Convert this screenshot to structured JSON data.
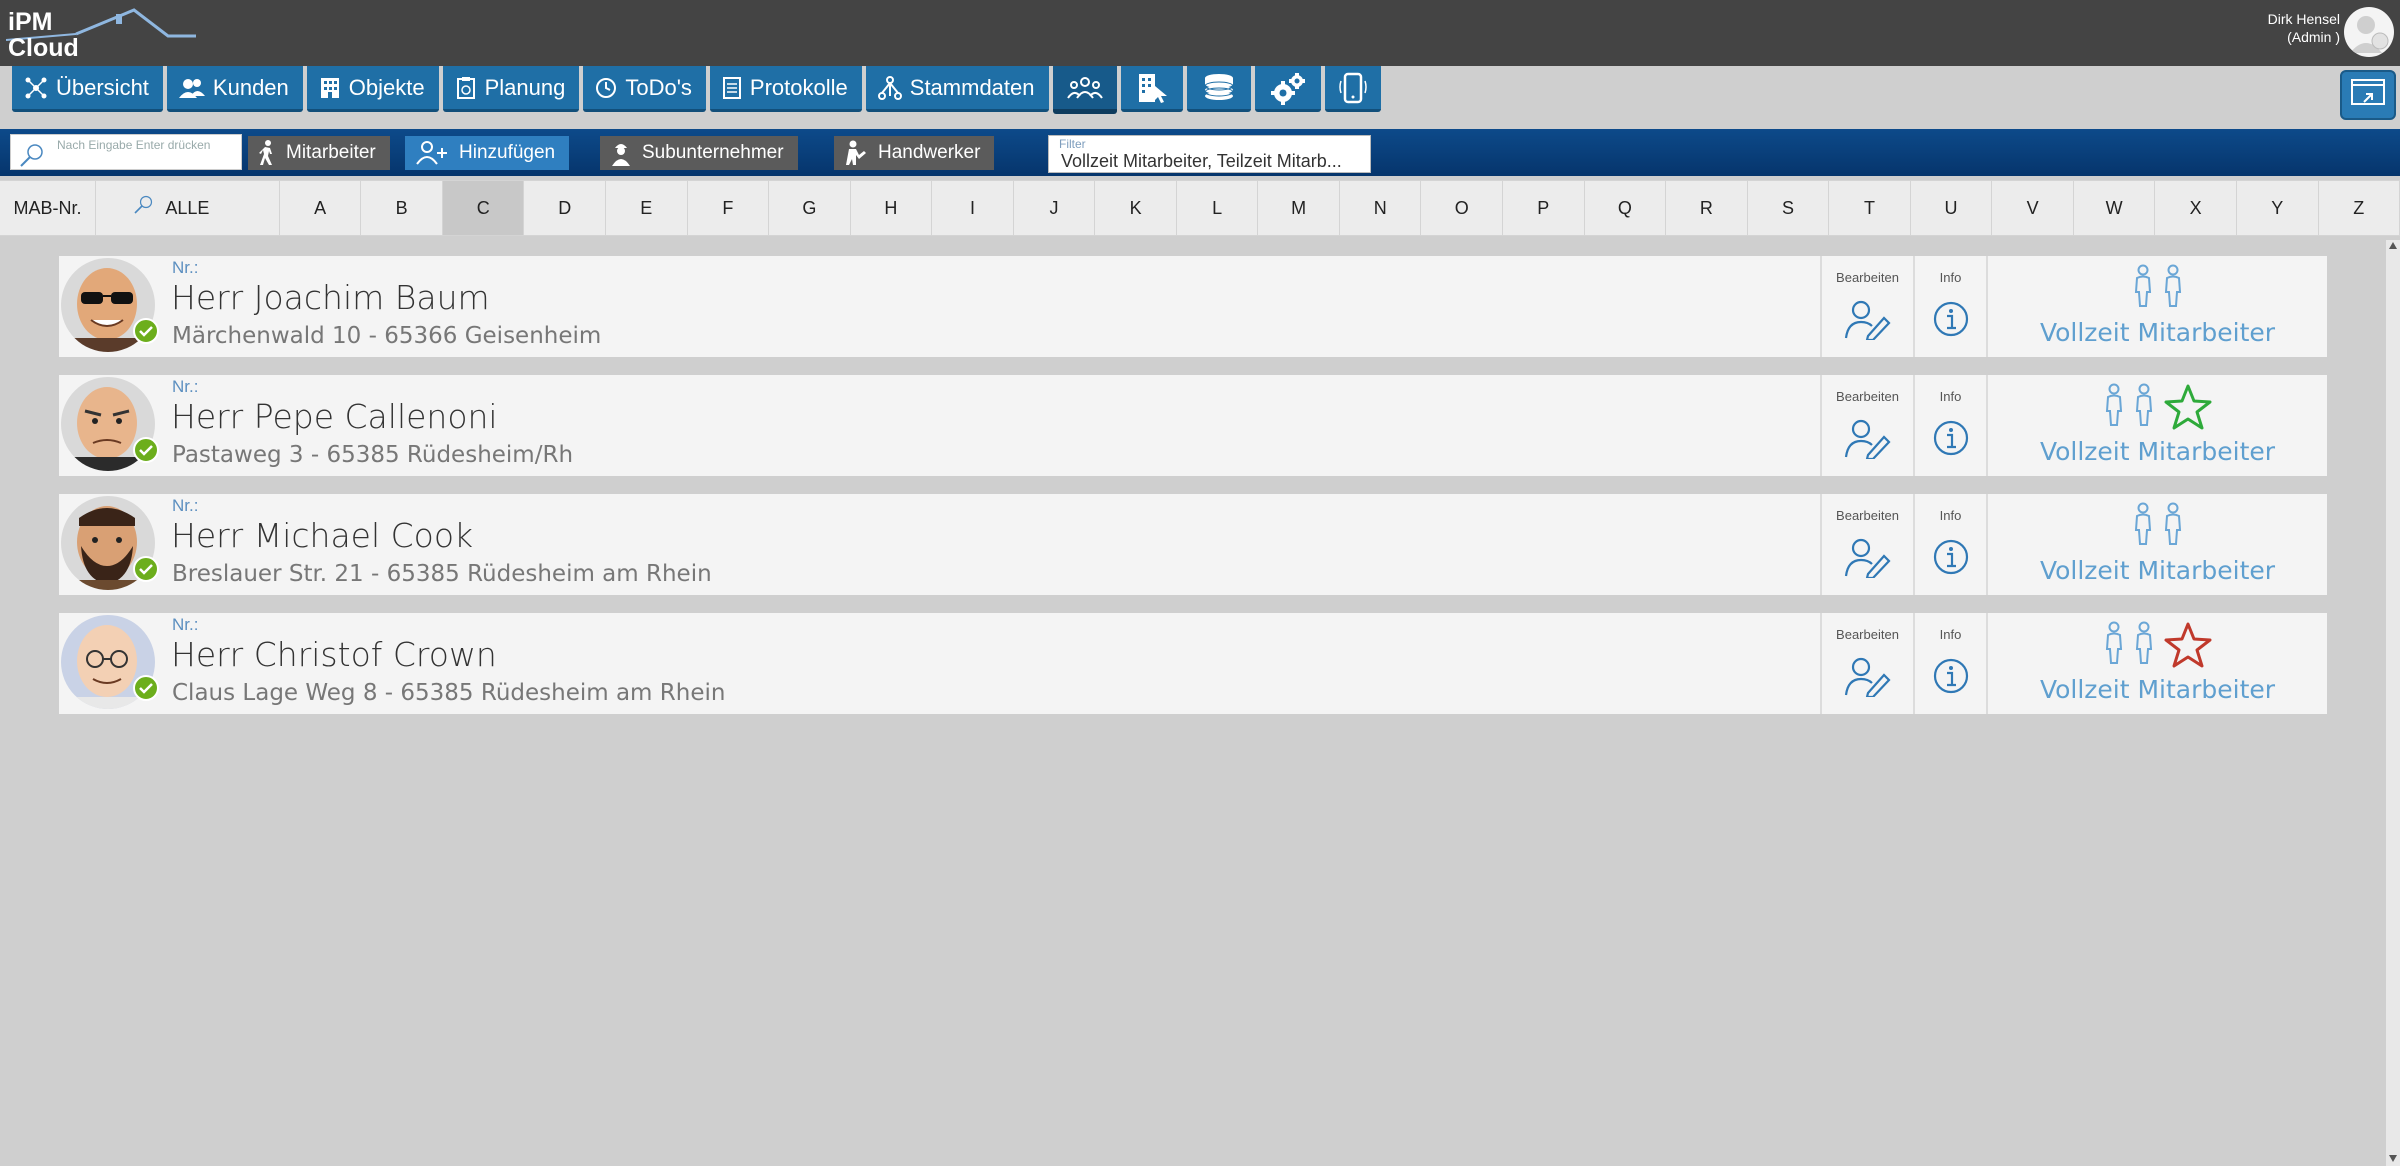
{
  "app": {
    "logo_line1": "iPM",
    "logo_line2": "Cloud"
  },
  "user": {
    "name": "Dirk Hensel",
    "role": "(Admin )"
  },
  "nav": {
    "items": [
      {
        "label": "Übersicht",
        "icon": "network-icon"
      },
      {
        "label": "Kunden",
        "icon": "users-icon"
      },
      {
        "label": "Objekte",
        "icon": "building-icon"
      },
      {
        "label": "Planung",
        "icon": "clipboard-icon"
      },
      {
        "label": "ToDo's",
        "icon": "clock-icon"
      },
      {
        "label": "Protokolle",
        "icon": "document-icon"
      },
      {
        "label": "Stammdaten",
        "icon": "hierarchy-icon"
      }
    ]
  },
  "toolbar": {
    "search_placeholder": "Nach Eingabe Enter drücken",
    "mitarbeiter": "Mitarbeiter",
    "hinzufuegen": "Hinzufügen",
    "subunternehmer": "Subunternehmer",
    "handwerker": "Handwerker",
    "filter_label": "Filter",
    "filter_value": "Vollzeit Mitarbeiter, Teilzeit Mitarb..."
  },
  "alpha": {
    "mab": "MAB-Nr.",
    "all": "ALLE",
    "letters": [
      "A",
      "B",
      "C",
      "D",
      "E",
      "F",
      "G",
      "H",
      "I",
      "J",
      "K",
      "L",
      "M",
      "N",
      "O",
      "P",
      "Q",
      "R",
      "S",
      "T",
      "U",
      "V",
      "W",
      "X",
      "Y",
      "Z"
    ],
    "selected": "C"
  },
  "columns": {
    "edit": "Bearbeiten",
    "info": "Info"
  },
  "employees": [
    {
      "nr": "Nr.:",
      "name": "Herr Joachim Baum",
      "address": "Märchenwald 10  -  65366 Geisenheim",
      "type": "Vollzeit Mitarbeiter",
      "star": "none"
    },
    {
      "nr": "Nr.:",
      "name": "Herr Pepe Callenoni",
      "address": "Pastaweg 3  -  65385 Rüdesheim/Rh",
      "type": "Vollzeit Mitarbeiter",
      "star": "green"
    },
    {
      "nr": "Nr.:",
      "name": "Herr Michael Cook",
      "address": "Breslauer Str. 21  -  65385 Rüdesheim am Rhein",
      "type": "Vollzeit Mitarbeiter",
      "star": "none"
    },
    {
      "nr": "Nr.:",
      "name": "Herr Christof Crown",
      "address": "Claus Lage Weg 8  -  65385 Rüdesheim am Rhein",
      "type": "Vollzeit Mitarbeiter",
      "star": "red"
    }
  ],
  "colors": {
    "nav": "#1f6fa6",
    "toolbar": "#0d4a8a",
    "accent_text": "#5f9fcf",
    "star_green": "#2eaa3a",
    "star_red": "#c0392b",
    "ok_badge": "#6cae1c"
  }
}
